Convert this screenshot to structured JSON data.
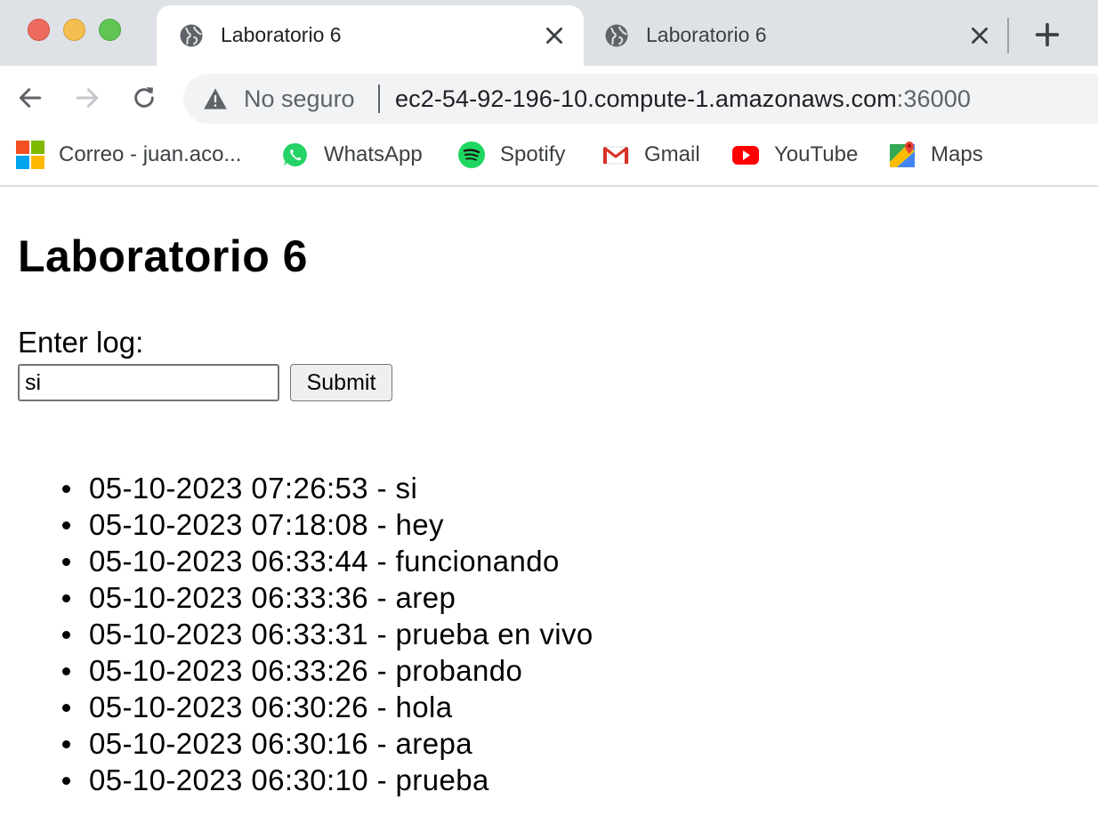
{
  "browser": {
    "tabs": [
      {
        "title": "Laboratorio 6",
        "active": true
      },
      {
        "title": "Laboratorio 6",
        "active": false
      }
    ],
    "address_bar": {
      "security_label": "No seguro",
      "url_host": "ec2-54-92-196-10.compute-1.amazonaws.com",
      "url_port": ":36000"
    },
    "bookmarks": [
      {
        "label": "Correo - juan.aco...",
        "icon": "microsoft-icon"
      },
      {
        "label": "WhatsApp",
        "icon": "whatsapp-icon"
      },
      {
        "label": "Spotify",
        "icon": "spotify-icon"
      },
      {
        "label": "Gmail",
        "icon": "gmail-icon"
      },
      {
        "label": "YouTube",
        "icon": "youtube-icon"
      },
      {
        "label": "Maps",
        "icon": "maps-icon"
      }
    ]
  },
  "page": {
    "title": "Laboratorio 6",
    "form": {
      "label": "Enter log:",
      "input_value": "si",
      "submit_label": "Submit"
    },
    "logs": [
      "05-10-2023 07:26:53 - si",
      "05-10-2023 07:18:08 - hey",
      "05-10-2023 06:33:44 - funcionando",
      "05-10-2023 06:33:36 - arep",
      "05-10-2023 06:33:31 - prueba en vivo",
      "05-10-2023 06:33:26 - probando",
      "05-10-2023 06:30:26 - hola",
      "05-10-2023 06:30:16 - arepa",
      "05-10-2023 06:30:10 - prueba"
    ]
  },
  "colors": {
    "tabstrip_bg": "#dee1e6",
    "omnibox_bg": "#f1f3f4",
    "traffic_red": "#ed6a5e",
    "traffic_yellow": "#f5bf4f",
    "traffic_green": "#61c554"
  }
}
